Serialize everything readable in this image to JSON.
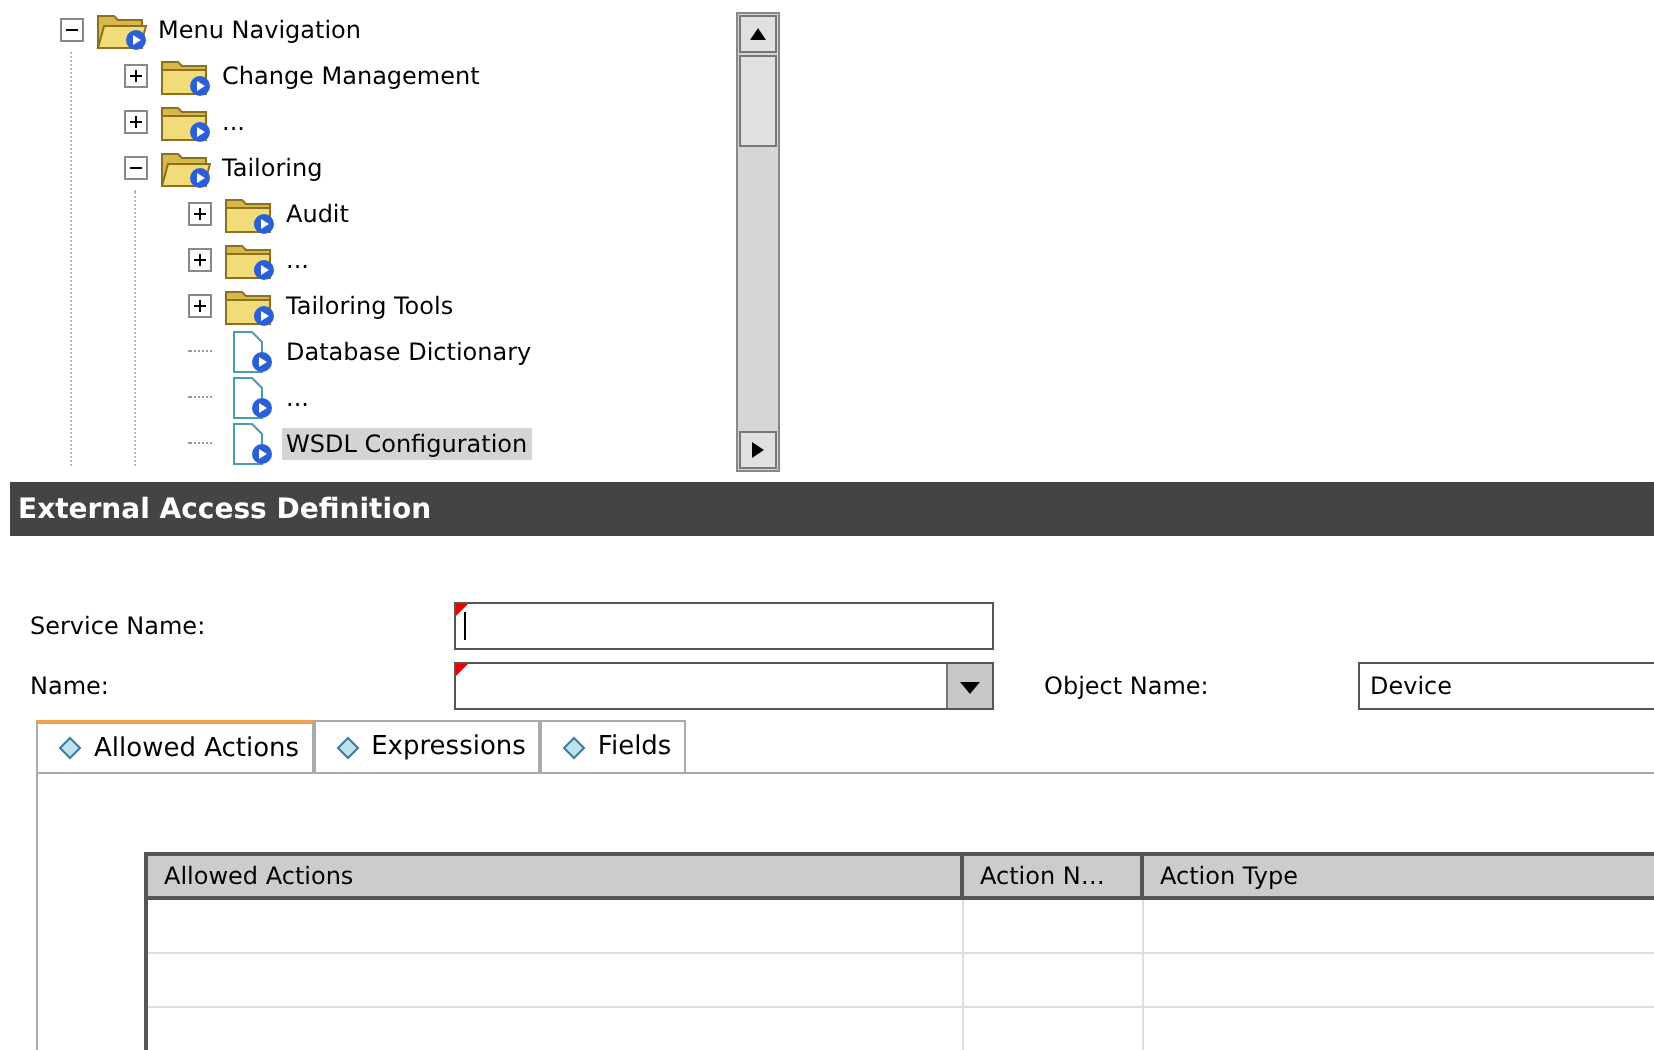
{
  "tree": {
    "items": [
      {
        "label": "Menu Navigation",
        "kind": "folder",
        "expanded": true,
        "selected": false,
        "children": [
          {
            "label": "Change Management",
            "kind": "folder",
            "expanded": false,
            "selected": false
          },
          {
            "label": "...",
            "kind": "folder",
            "expanded": false,
            "selected": false
          },
          {
            "label": "Tailoring",
            "kind": "folder",
            "expanded": true,
            "selected": false,
            "children": [
              {
                "label": "Audit",
                "kind": "folder",
                "expanded": false,
                "selected": false
              },
              {
                "label": "...",
                "kind": "folder",
                "expanded": false,
                "selected": false
              },
              {
                "label": "Tailoring Tools",
                "kind": "folder",
                "expanded": false,
                "selected": false
              },
              {
                "label": "Database Dictionary",
                "kind": "document",
                "selected": false
              },
              {
                "label": "...",
                "kind": "document",
                "selected": false
              },
              {
                "label": "WSDL Configuration",
                "kind": "document",
                "selected": true
              }
            ]
          }
        ]
      }
    ]
  },
  "panel": {
    "title": "External Access Definition"
  },
  "form": {
    "service_name": {
      "label": "Service Name:",
      "required": true
    },
    "name": {
      "label": "Name:",
      "required": true
    },
    "object_name": {
      "label": "Object Name:",
      "value": "Device"
    }
  },
  "tabs": [
    {
      "label": "Allowed Actions",
      "selected": true
    },
    {
      "label": "Expressions",
      "selected": false
    },
    {
      "label": "Fields",
      "selected": false
    }
  ],
  "table": {
    "columns": [
      "Allowed Actions",
      "Action N…",
      "Action Type"
    ]
  }
}
